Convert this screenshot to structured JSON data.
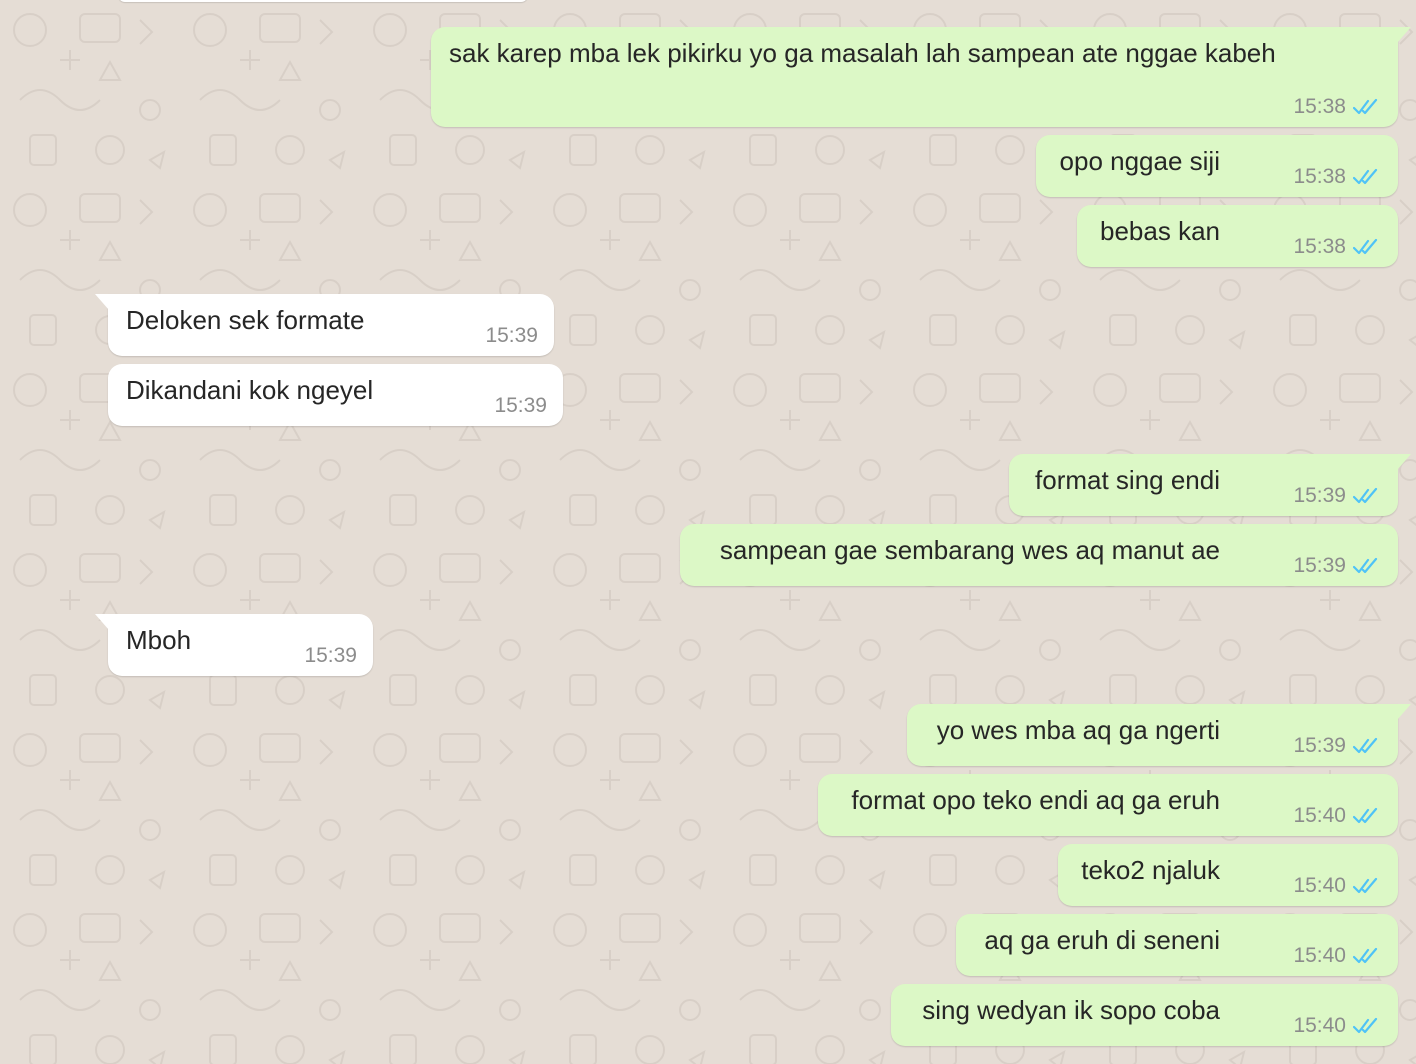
{
  "chat": {
    "colors": {
      "background": "#e5ddd5",
      "outgoing_bubble": "#dcf8c6",
      "incoming_bubble": "#ffffff",
      "read_ticks": "#4fc3f7",
      "timestamp": "#8c8c8c"
    },
    "messages": [
      {
        "direction": "outgoing",
        "text": "sak karep mba lek pikirku yo ga masalah lah sampean ate nggae kabeh",
        "time": "15:38",
        "status_icon": "double-check-read-icon"
      },
      {
        "direction": "outgoing",
        "text": "opo nggae siji",
        "time": "15:38",
        "status_icon": "double-check-read-icon"
      },
      {
        "direction": "outgoing",
        "text": "bebas kan",
        "time": "15:38",
        "status_icon": "double-check-read-icon"
      },
      {
        "direction": "incoming",
        "text": "Deloken sek formate",
        "time": "15:39"
      },
      {
        "direction": "incoming",
        "text": "Dikandani kok ngeyel",
        "time": "15:39"
      },
      {
        "direction": "outgoing",
        "text": "format sing endi",
        "time": "15:39",
        "status_icon": "double-check-read-icon"
      },
      {
        "direction": "outgoing",
        "text": "sampean gae sembarang wes aq manut ae",
        "time": "15:39",
        "status_icon": "double-check-read-icon"
      },
      {
        "direction": "incoming",
        "text": "Mboh",
        "time": "15:39"
      },
      {
        "direction": "outgoing",
        "text": "yo wes mba aq ga ngerti",
        "time": "15:39",
        "status_icon": "double-check-read-icon"
      },
      {
        "direction": "outgoing",
        "text": "format opo teko endi aq ga eruh",
        "time": "15:40",
        "status_icon": "double-check-read-icon"
      },
      {
        "direction": "outgoing",
        "text": "teko2 njaluk",
        "time": "15:40",
        "status_icon": "double-check-read-icon"
      },
      {
        "direction": "outgoing",
        "text": "aq ga eruh di seneni",
        "time": "15:40",
        "status_icon": "double-check-read-icon"
      },
      {
        "direction": "outgoing",
        "text": "sing wedyan ik sopo coba",
        "time": "15:40",
        "status_icon": "double-check-read-icon"
      }
    ]
  }
}
